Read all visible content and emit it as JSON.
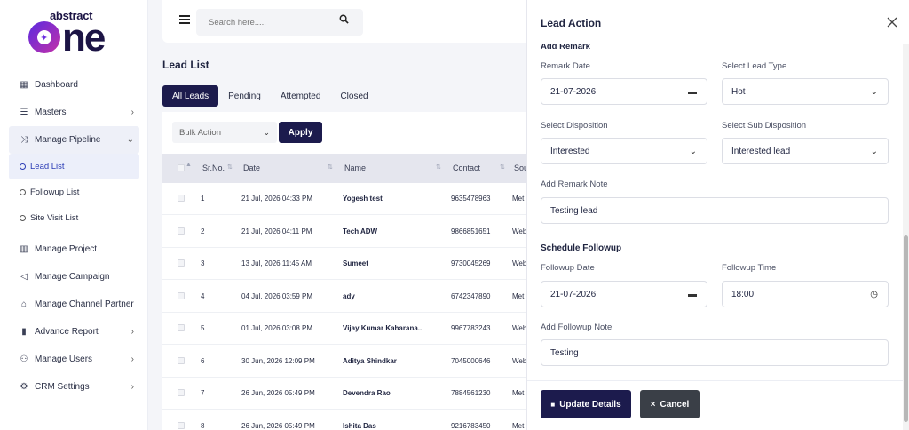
{
  "brand": {
    "word_top": "abstract",
    "word_main": "one"
  },
  "sidebar": {
    "items": [
      {
        "label": "Dashboard",
        "icon": "dashboard-icon",
        "glyph": "▦"
      },
      {
        "label": "Masters",
        "icon": "list-icon",
        "glyph": "☰",
        "chevron": "›"
      },
      {
        "label": "Manage Pipeline",
        "icon": "pipeline-icon",
        "glyph": "⤨",
        "chevron": "⌄"
      }
    ],
    "sub_items": [
      {
        "label": "Lead List",
        "active": true
      },
      {
        "label": "Followup List"
      },
      {
        "label": "Site Visit List"
      }
    ],
    "items2": [
      {
        "label": "Manage Project",
        "icon": "building-icon",
        "glyph": "▥"
      },
      {
        "label": "Manage Campaign",
        "icon": "megaphone-icon",
        "glyph": "◁"
      },
      {
        "label": "Manage Channel Partner",
        "icon": "partner-icon",
        "glyph": "⌂"
      },
      {
        "label": "Advance Report",
        "icon": "report-icon",
        "glyph": "▮",
        "chevron": "›"
      },
      {
        "label": "Manage Users",
        "icon": "users-icon",
        "glyph": "⚇",
        "chevron": "›"
      },
      {
        "label": "CRM Settings",
        "icon": "gear-icon",
        "glyph": "⚙",
        "chevron": "›"
      }
    ]
  },
  "topbar": {
    "search_placeholder": "Search here....."
  },
  "main": {
    "title": "Lead List",
    "tabs": [
      "All Leads",
      "Pending",
      "Attempted",
      "Closed"
    ],
    "bulk_action": "Bulk Action",
    "apply_label": "Apply",
    "columns": [
      "Sr.No.",
      "Date",
      "Name",
      "Contact",
      "Sou"
    ],
    "rows": [
      {
        "sr": "1",
        "date": "21 Jul, 2026 04:33 PM",
        "name": "Yogesh test",
        "contact": "9635478963",
        "source": "Met"
      },
      {
        "sr": "2",
        "date": "21 Jul, 2026 04:11 PM",
        "name": "Tech ADW",
        "contact": "9866851651",
        "source": "Web"
      },
      {
        "sr": "3",
        "date": "13 Jul, 2026 11:45 AM",
        "name": "Sumeet",
        "contact": "9730045269",
        "source": "Web"
      },
      {
        "sr": "4",
        "date": "04 Jul, 2026 03:59 PM",
        "name": "ady",
        "contact": "6742347890",
        "source": "Met"
      },
      {
        "sr": "5",
        "date": "01 Jul, 2026 03:08 PM",
        "name": "Vijay Kumar Kaharana..",
        "contact": "9967783243",
        "source": "Web"
      },
      {
        "sr": "6",
        "date": "30 Jun, 2026 12:09 PM",
        "name": "Aditya Shindkar",
        "contact": "7045000646",
        "source": "Web"
      },
      {
        "sr": "7",
        "date": "26 Jun, 2026 05:49 PM",
        "name": "Devendra Rao",
        "contact": "7884561230",
        "source": "Met"
      },
      {
        "sr": "8",
        "date": "26 Jun, 2026 05:49 PM",
        "name": "Ishita Das",
        "contact": "9216783450",
        "source": "Met"
      }
    ]
  },
  "modal": {
    "title": "Lead Action",
    "section_remark": "Add Remark",
    "remark_date_label": "Remark Date",
    "remark_date": "21-07-2026",
    "lead_type_label": "Select Lead Type",
    "lead_type": "Hot",
    "disposition_label": "Select Disposition",
    "disposition": "Interested",
    "sub_disposition_label": "Select Sub Disposition",
    "sub_disposition": "Interested lead",
    "remark_note_label": "Add Remark Note",
    "remark_note": "Testing lead",
    "section_followup": "Schedule Followup",
    "followup_date_label": "Followup Date",
    "followup_date": "21-07-2026",
    "followup_time_label": "Followup Time",
    "followup_time": "18:00",
    "followup_note_label": "Add Followup Note",
    "followup_note": "Testing",
    "update_label": "Update Details",
    "cancel_label": "Cancel"
  }
}
